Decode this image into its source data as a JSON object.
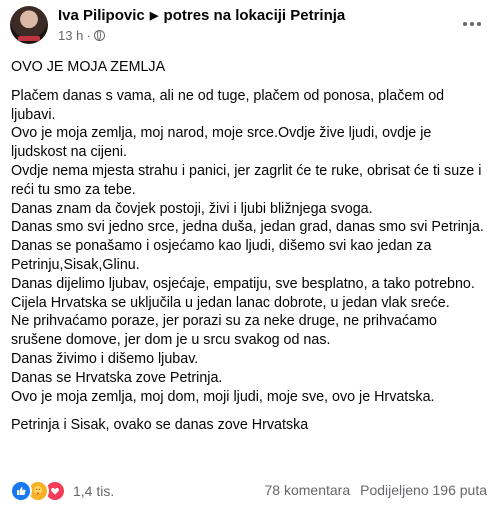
{
  "header": {
    "author": "Iva Pilipovic",
    "arrow": "▶",
    "action": "potres na lokaciji Petrinja",
    "time": "13 h",
    "dot": "·"
  },
  "post": {
    "lines": [
      "OVO JE MOJA ZEMLJA",
      "",
      "Plačem danas s vama, ali ne od tuge, plačem od ponosa, plačem od ljubavi.",
      "Ovo je moja zemlja, moj narod, moje srce.Ovdje žive ljudi, ovdje je ljudskost na cijeni.",
      "Ovdje nema mjesta strahu i panici, jer zagrlit će te ruke, obrisat će ti suze i reći tu smo za tebe.",
      "Danas znam da čovjek postoji, živi i ljubi bližnjega svoga.",
      "Danas smo svi jedno srce, jedna duša, jedan grad, danas smo svi Petrinja.",
      "Danas se ponašamo i osjećamo kao ljudi, dišemo svi kao jedan za Petrinju,Sisak,Glinu.",
      "Danas dijelimo ljubav, osjećaje, empatiju, sve besplatno, a tako potrebno.",
      "Cijela Hrvatska se uključila u jedan lanac dobrote, u jedan vlak sreće.",
      "Ne prihvaćamo poraze, jer porazi su za neke druge, ne prihvaćamo srušene domove, jer dom je u srcu svakog od nas.",
      "Danas živimo i dišemo ljubav.",
      "Danas se Hrvatska zove Petrinja.",
      "Ovo je moja zemlja, moj dom, moji ljudi, moje sve, ovo je Hrvatska.",
      "",
      "Petrinja i Sisak, ovako se danas zove Hrvatska"
    ]
  },
  "footer": {
    "reaction_count": "1,4 tis.",
    "comments": "78 komentara",
    "shares": "Podijeljeno 196 puta"
  },
  "icons": {
    "like": "like-icon",
    "care": "care-icon",
    "love": "love-icon",
    "globe": "globe-icon",
    "more": "more-options-icon"
  },
  "colors": {
    "like": "#1877f2",
    "care": "#f7b125",
    "love": "#f33e58",
    "meta_text": "#65676b"
  }
}
